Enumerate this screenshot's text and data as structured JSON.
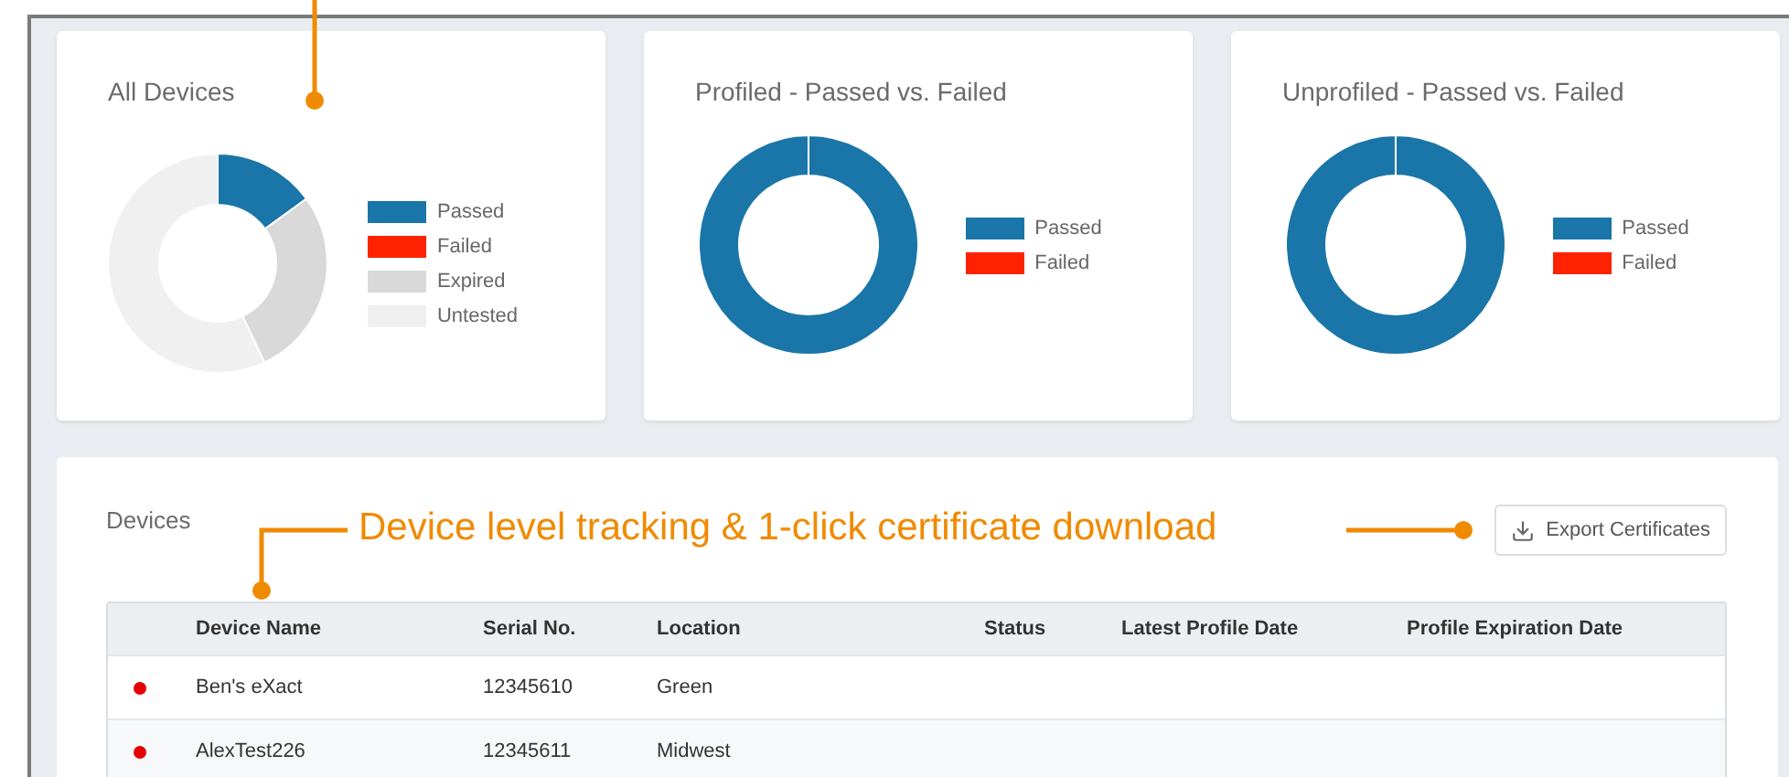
{
  "charts": [
    {
      "title": "All Devices",
      "legend": [
        {
          "label": "Passed",
          "color": "#1a75a8"
        },
        {
          "label": "Failed",
          "color": "#ff2200"
        },
        {
          "label": "Expired",
          "color": "#d9d9d9"
        },
        {
          "label": "Untested",
          "color": "#f0f0f0"
        }
      ]
    },
    {
      "title": "Profiled - Passed vs. Failed",
      "legend": [
        {
          "label": "Passed",
          "color": "#1a75a8"
        },
        {
          "label": "Failed",
          "color": "#ff2200"
        }
      ]
    },
    {
      "title": "Unprofiled - Passed vs. Failed",
      "legend": [
        {
          "label": "Passed",
          "color": "#1a75a8"
        },
        {
          "label": "Failed",
          "color": "#ff2200"
        }
      ]
    }
  ],
  "devices": {
    "title": "Devices",
    "export_button": "Export Certificates",
    "columns": [
      "Device Name",
      "Serial No.",
      "Location",
      "Status",
      "Latest Profile Date",
      "Profile Expiration Date"
    ],
    "rows": [
      {
        "name": "Ben's eXact",
        "serial": "12345610",
        "location": "Green",
        "color": "#e60000"
      },
      {
        "name": "AlexTest226",
        "serial": "12345611",
        "location": "Midwest",
        "color": "#e60000"
      }
    ]
  },
  "callout": "Device level tracking & 1-click certificate download"
}
